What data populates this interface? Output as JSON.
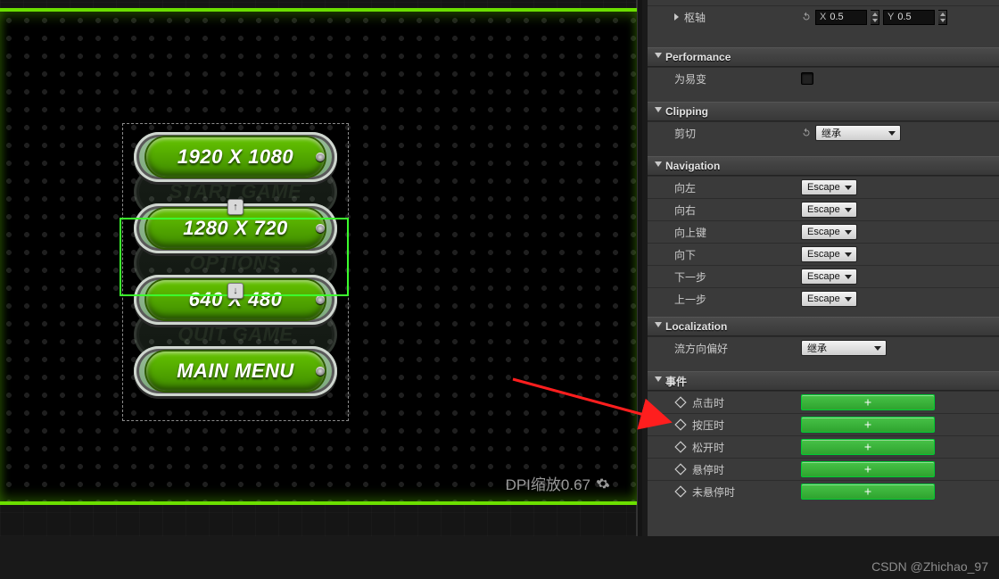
{
  "viewport": {
    "dpi_label": "DPI缩放0.67",
    "buttons": [
      {
        "label": "1920 X 1080"
      },
      {
        "label": "1280 X 720"
      },
      {
        "label": "640 X 480"
      },
      {
        "label": "MAIN MENU"
      }
    ],
    "ghost_labels": [
      "START GAME",
      "OPTIONS",
      "QUIT GAME"
    ]
  },
  "panel": {
    "pivot": {
      "label": "枢轴",
      "x_label": "X",
      "x_value": "0.5",
      "y_label": "Y",
      "y_value": "0.5"
    },
    "categories": {
      "performance": {
        "title": "Performance",
        "rows": {
          "volatile": "为易变"
        }
      },
      "clipping": {
        "title": "Clipping",
        "rows": {
          "clip": "剪切"
        },
        "clip_value": "继承"
      },
      "navigation": {
        "title": "Navigation",
        "rows": {
          "left": "向左",
          "right": "向右",
          "up": "向上键",
          "down": "向下",
          "next": "下一步",
          "prev": "上一步"
        },
        "value": "Escape"
      },
      "localization": {
        "title": "Localization",
        "rows": {
          "flow": "流方向偏好"
        },
        "value": "继承"
      },
      "events": {
        "title": "事件",
        "rows": {
          "onclick": "点击时",
          "onpress": "按压时",
          "onrelease": "松开时",
          "onhover": "悬停时",
          "onunhover": "未悬停时"
        }
      }
    }
  },
  "watermark": "CSDN @Zhichao_97"
}
